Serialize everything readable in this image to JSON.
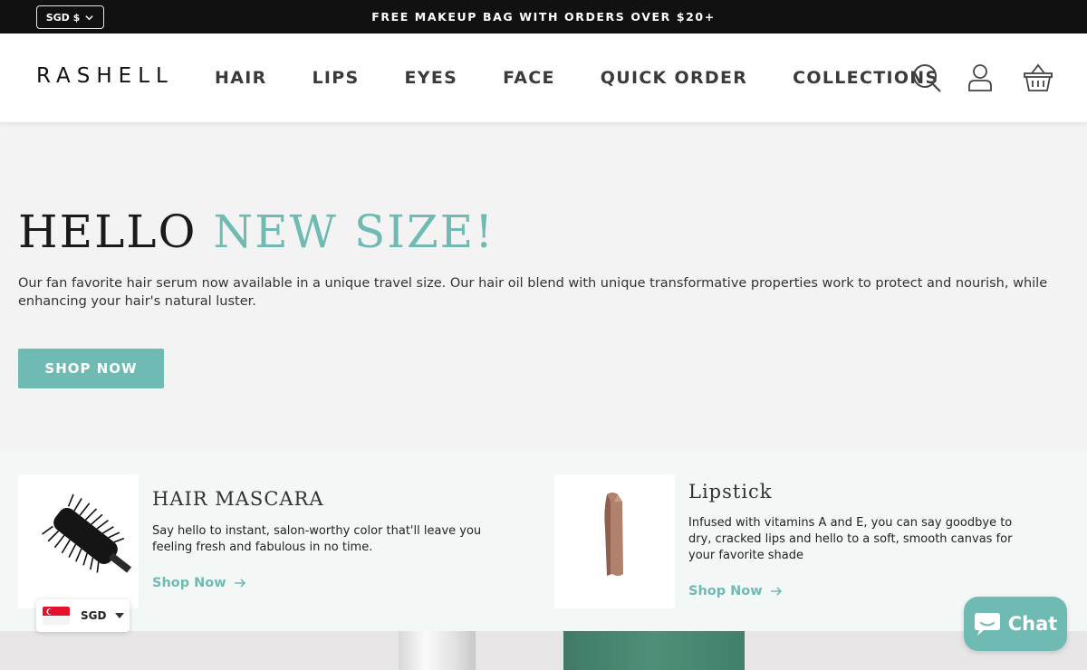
{
  "announcement": {
    "currency_label": "SGD $",
    "text": "FREE MAKEUP BAG WITH ORDERS OVER $20+"
  },
  "header": {
    "logo": "RASHELL",
    "nav": [
      "HAIR",
      "LIPS",
      "EYES",
      "FACE",
      "QUICK ORDER",
      "COLLECTIONS"
    ],
    "icons": [
      "search-icon",
      "account-icon",
      "cart-basket-icon"
    ]
  },
  "hero": {
    "title_main": "HELLO ",
    "title_accent": "NEW SIZE!",
    "description": "Our fan favorite hair serum now available in a unique travel size. Our hair oil blend with unique transformative properties work to protect and nourish, while enhancing your hair's natural luster.",
    "button": "SHOP NOW"
  },
  "features": [
    {
      "title": "HAIR MASCARA",
      "description": "Say hello to instant, salon-worthy color that'll leave you feeling fresh and fabulous in no time.",
      "link": "Shop Now"
    },
    {
      "title": "Lipstick",
      "description": "Infused with vitamins A and E, you can say goodbye to dry, cracked lips and hello to a soft, smooth canvas for your favorite shade",
      "link": "Shop Now"
    }
  ],
  "currency_widget": {
    "code": "SGD"
  },
  "chat": {
    "label": "Chat"
  },
  "colors": {
    "accent": "#6fbab2",
    "topbar": "#111111",
    "hero_bg": "#f3f3f3",
    "features_bg": "#f3f8f7"
  }
}
